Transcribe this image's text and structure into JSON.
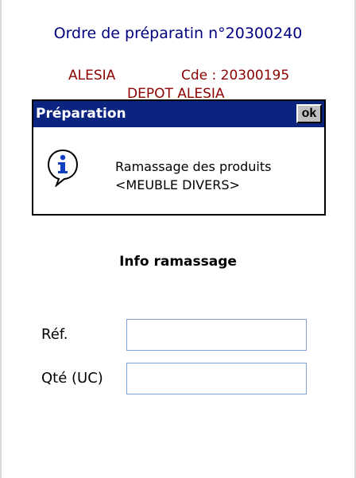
{
  "header": {
    "order_title": "Ordre de préparatin n°20300240",
    "client_name": "ALESIA",
    "order_ref": "Cde : 20300195",
    "depot": "DEPOT ALESIA"
  },
  "dialog": {
    "title": "Préparation",
    "ok_label": "ok",
    "icon": "info-icon",
    "message_line1": "Ramassage des produits",
    "message_line2": "<MEUBLE DIVERS>"
  },
  "form": {
    "section_title": "Info ramassage",
    "ref_label": "Réf.",
    "ref_value": "",
    "qte_label": "Qté (UC)",
    "qte_value": ""
  },
  "colors": {
    "title_text": "#000080",
    "header_text": "#8b0000",
    "dialog_titlebar": "#0a2480",
    "input_border": "#7fa0d8"
  }
}
